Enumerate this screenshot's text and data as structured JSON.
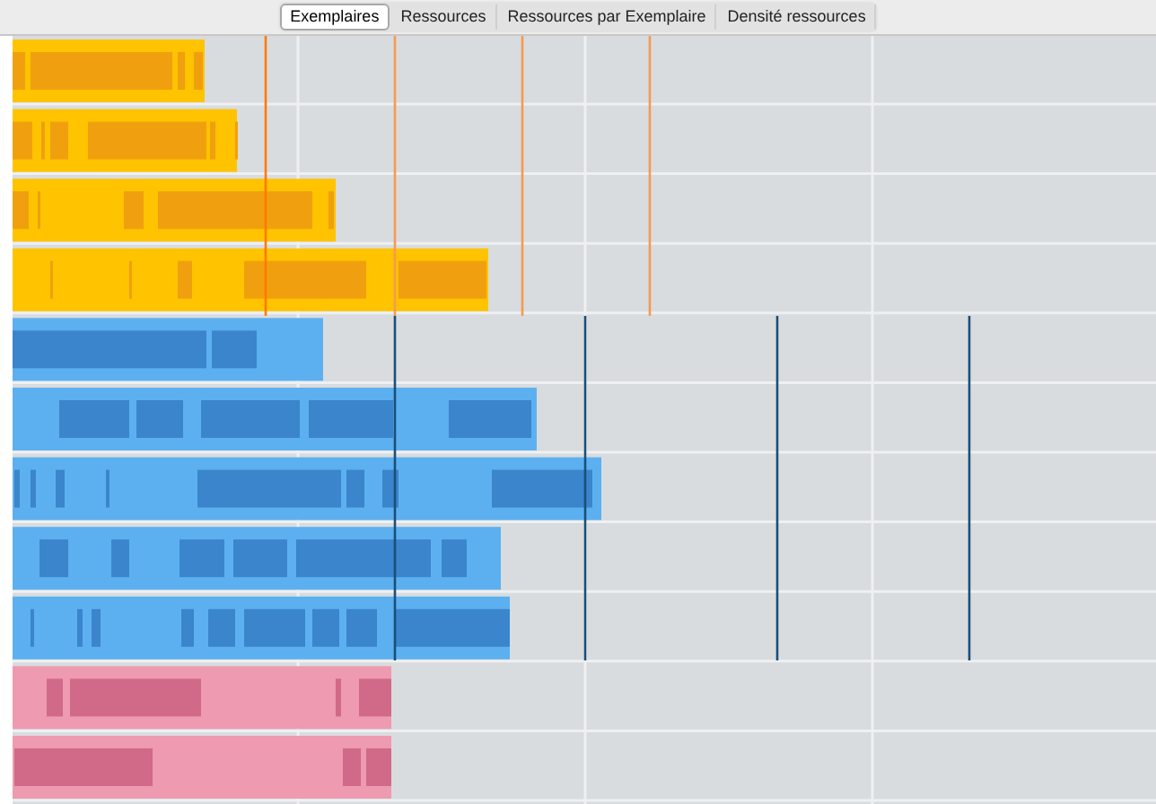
{
  "tabs": [
    {
      "label": "Exemplaires",
      "selected": true
    },
    {
      "label": "Ressources",
      "selected": false
    },
    {
      "label": "Ressources par Exemplaire",
      "selected": false
    },
    {
      "label": "Densité ressources",
      "selected": false
    }
  ]
}
